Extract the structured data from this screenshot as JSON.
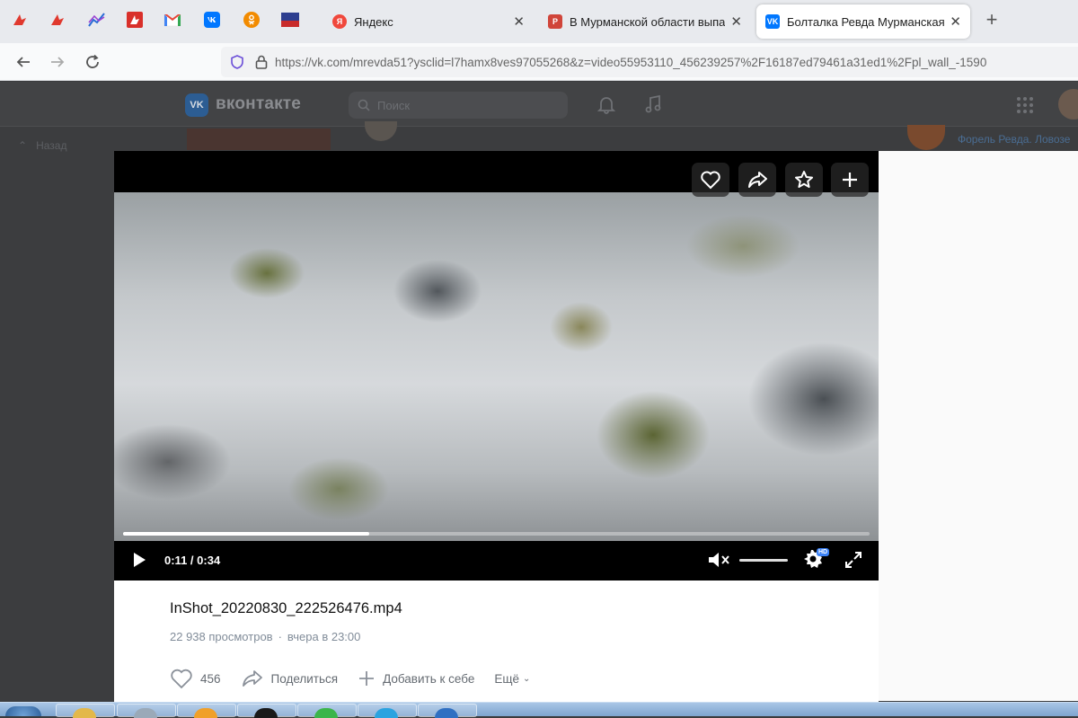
{
  "browser": {
    "tabs": [
      {
        "title": "Яндекс",
        "icon": "yandex-icon",
        "color": "#f0483c",
        "glyph": "Я"
      },
      {
        "title": "В Мурманской области выпал",
        "icon": "news-icon",
        "color": "#d0453a",
        "glyph": "Р"
      },
      {
        "title": "Болталка Ревда Мурманская",
        "icon": "vk-icon",
        "color": "#0077ff",
        "glyph": "VK",
        "active": true
      }
    ],
    "url": "https://vk.com/mrevda51?ysclid=l7hamx8ves97055268&z=video55953110_456239257%2F16187ed79461a31ed1%2Fpl_wall_-1590"
  },
  "vk": {
    "brand": "вконтакте",
    "logo_text": "VK",
    "search_placeholder": "Поиск",
    "left_nav": "Назад",
    "right_link": "Форель Ревда. Ловозе"
  },
  "video": {
    "time_current": "0:11",
    "time_sep": " / ",
    "time_total": "0:34",
    "progress": 0.33,
    "volume": 0,
    "quality_badge": "HD",
    "title": "InShot_20220830_222526476.mp4",
    "views": "22 938 просмотров",
    "meta_sep": "·",
    "date": "вчера в 23:00",
    "likes": "456",
    "share_label": "Поделиться",
    "add_label": "Добавить к себе",
    "more_label": "Ещё"
  }
}
